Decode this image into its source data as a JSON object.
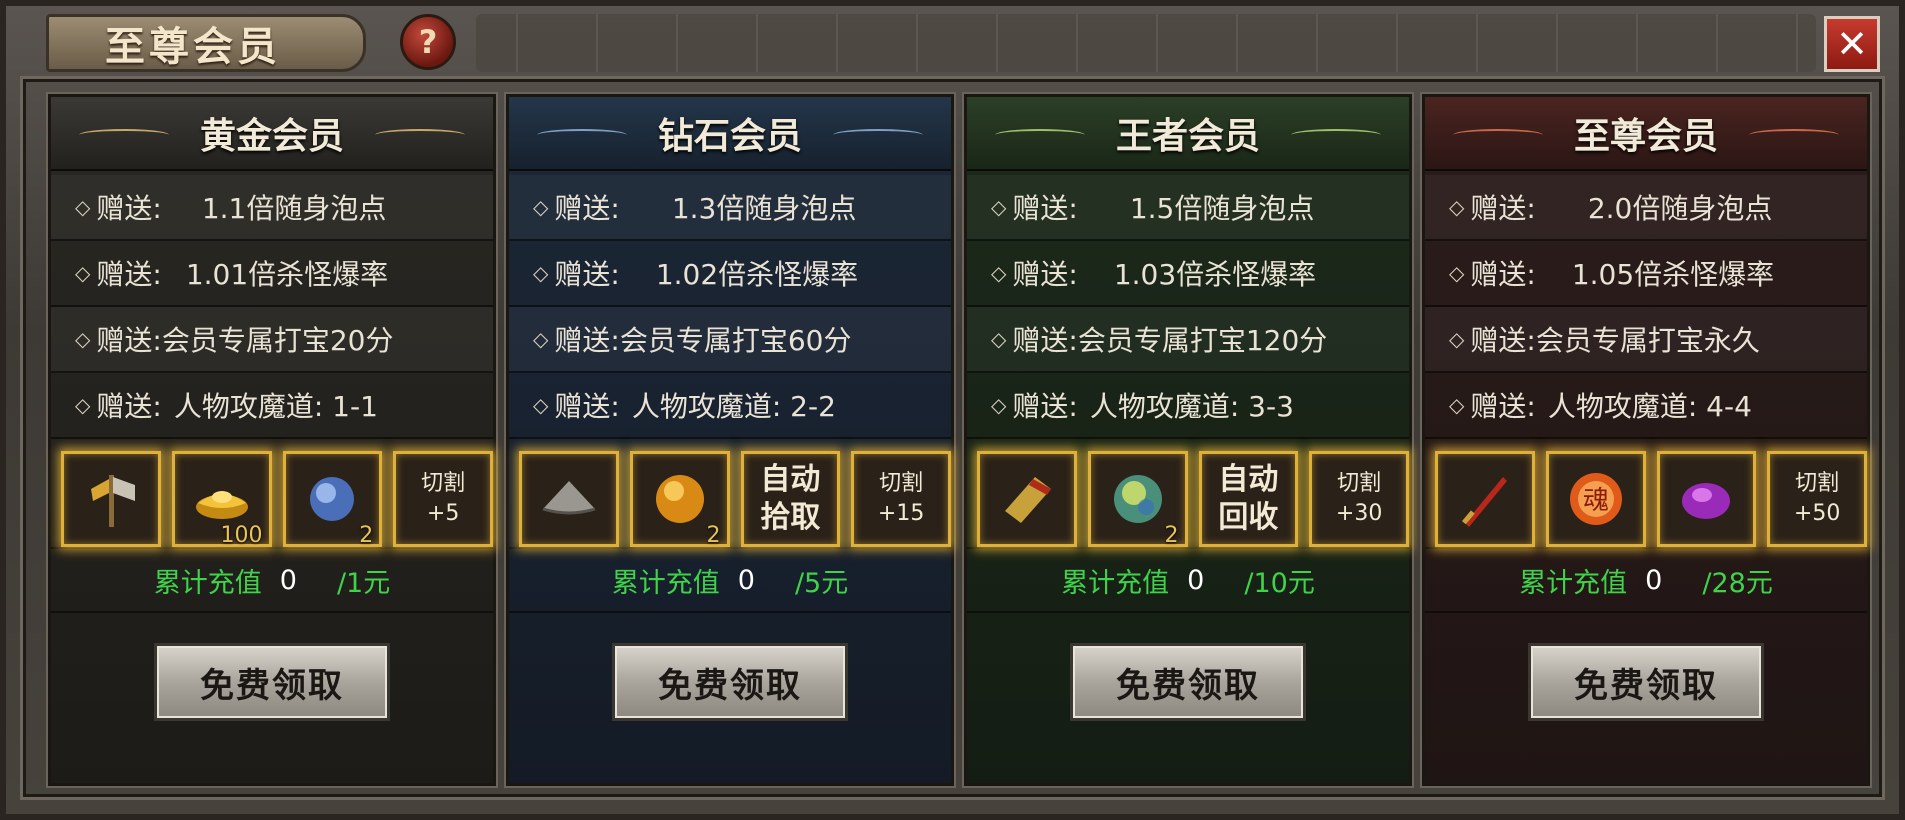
{
  "window": {
    "title": "至尊会员",
    "help_label": "?",
    "close_label": "✕"
  },
  "panels": [
    {
      "title": "黄金会员",
      "theme": "gold",
      "rows": [
        {
          "prefix": "赠送:",
          "text": "1.1倍随身泡点"
        },
        {
          "prefix": "赠送:",
          "text": "1.01倍杀怪爆率"
        },
        {
          "prefix": "赠送:",
          "text": "会员专属打宝20分"
        },
        {
          "prefix": "赠送:",
          "text": "人物攻魔道:  1-1"
        }
      ],
      "items": [
        {
          "icon": "axe-icon",
          "count": ""
        },
        {
          "icon": "gold-ingot-icon",
          "count": "100"
        },
        {
          "icon": "blue-orb-icon",
          "count": "2"
        },
        {
          "icon": "text",
          "line1": "切割",
          "line2": "+5"
        }
      ],
      "recharge": {
        "label": "累计充值",
        "value": "0",
        "target": "/1元"
      },
      "button": "免费领取"
    },
    {
      "title": "钻石会员",
      "theme": "blue",
      "rows": [
        {
          "prefix": "赠送:",
          "text": "1.3倍随身泡点"
        },
        {
          "prefix": "赠送:",
          "text": "1.02倍杀怪爆率"
        },
        {
          "prefix": "赠送:",
          "text": "会员专属打宝60分"
        },
        {
          "prefix": "赠送:",
          "text": "人物攻魔道:  2-2"
        }
      ],
      "items": [
        {
          "icon": "hat-icon",
          "count": ""
        },
        {
          "icon": "gold-orb-icon",
          "count": "2"
        },
        {
          "icon": "text-big",
          "line1": "自动",
          "line2": "拾取"
        },
        {
          "icon": "text",
          "line1": "切割",
          "line2": "+15"
        }
      ],
      "recharge": {
        "label": "累计充值",
        "value": "0",
        "target": "/5元"
      },
      "button": "免费领取"
    },
    {
      "title": "王者会员",
      "theme": "green",
      "rows": [
        {
          "prefix": "赠送:",
          "text": "1.5倍随身泡点"
        },
        {
          "prefix": "赠送:",
          "text": "1.03倍杀怪爆率"
        },
        {
          "prefix": "赠送:",
          "text": "会员专属打宝120分"
        },
        {
          "prefix": "赠送:",
          "text": "人物攻魔道:  3-3"
        }
      ],
      "items": [
        {
          "icon": "book-icon",
          "count": ""
        },
        {
          "icon": "green-orb-icon",
          "count": "2"
        },
        {
          "icon": "text-big",
          "line1": "自动",
          "line2": "回收"
        },
        {
          "icon": "text",
          "line1": "切割",
          "line2": "+30"
        }
      ],
      "recharge": {
        "label": "累计充值",
        "value": "0",
        "target": "/10元"
      },
      "button": "免费领取"
    },
    {
      "title": "至尊会员",
      "theme": "red",
      "rows": [
        {
          "prefix": "赠送:",
          "text": "2.0倍随身泡点"
        },
        {
          "prefix": "赠送:",
          "text": "1.05倍杀怪爆率"
        },
        {
          "prefix": "赠送:",
          "text": "会员专属打宝永久"
        },
        {
          "prefix": "赠送:",
          "text": "人物攻魔道:  4-4"
        }
      ],
      "items": [
        {
          "icon": "sword-icon",
          "count": ""
        },
        {
          "icon": "soul-orb-icon",
          "count": "",
          "glyph": "魂"
        },
        {
          "icon": "purple-gem-icon",
          "count": ""
        },
        {
          "icon": "text",
          "line1": "切割",
          "line2": "+50"
        }
      ],
      "recharge": {
        "label": "累计充值",
        "value": "0",
        "target": "/28元"
      },
      "button": "免费领取"
    }
  ]
}
